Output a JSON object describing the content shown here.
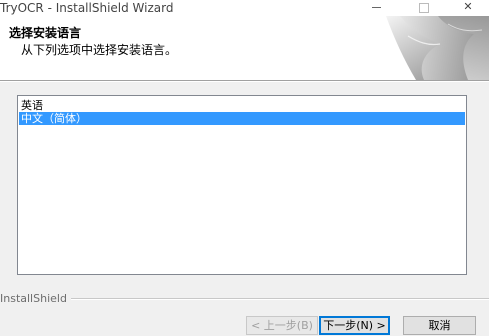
{
  "window": {
    "title": "TryOCR - InstallShield Wizard",
    "close_glyph": "✕"
  },
  "header": {
    "title": "选择安装语言",
    "subtitle": "从下列选项中选择安装语言。"
  },
  "language_list": {
    "items": [
      {
        "label": "英语",
        "selected": false
      },
      {
        "label": "中文（简体）",
        "selected": true
      }
    ]
  },
  "footer": {
    "brand": "InstallShield"
  },
  "buttons": {
    "back": "< 上一步(B)",
    "next": "下一步(N) >",
    "cancel": "取消"
  },
  "colors": {
    "selection": "#3399ff",
    "default_button_border": "#0078d7"
  }
}
